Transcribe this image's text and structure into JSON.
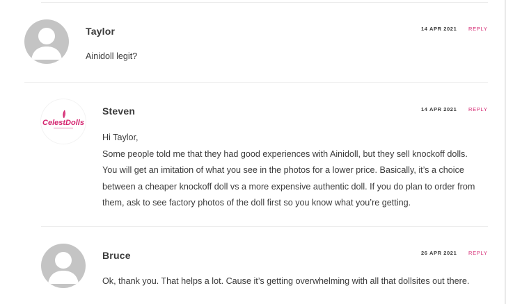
{
  "comments": [
    {
      "author": "Taylor",
      "date": "14 APR 2021",
      "reply_label": "REPLY",
      "avatar": "generic-user-icon",
      "body": [
        "Ainidoll legit?"
      ]
    },
    {
      "author": "Steven",
      "date": "14 APR 2021",
      "reply_label": "REPLY",
      "avatar": "celestdolls-logo",
      "logo_text": "CelestDolls",
      "body": [
        "Hi Taylor,",
        "Some people told me that they had good experiences with Ainidoll, but they sell knockoff dolls.",
        "You will get an imitation of what you see in the photos for a lower price. Basically, it’s a choice",
        "between a cheaper knockoff doll vs a more expensive authentic doll. If you do plan to order from",
        "them, ask to see factory photos of the doll first so you know what you’re getting."
      ]
    },
    {
      "author": "Bruce",
      "date": "26 APR 2021",
      "reply_label": "REPLY",
      "avatar": "generic-user-icon",
      "body": [
        "Ok, thank you. That helps a lot. Cause it’s getting overwhelming with all that dollsites out there."
      ]
    }
  ],
  "colors": {
    "accent": "#d4246f",
    "text": "#3a3a3a",
    "avatar_bg": "#c4c4c4",
    "divider": "#ececec"
  }
}
